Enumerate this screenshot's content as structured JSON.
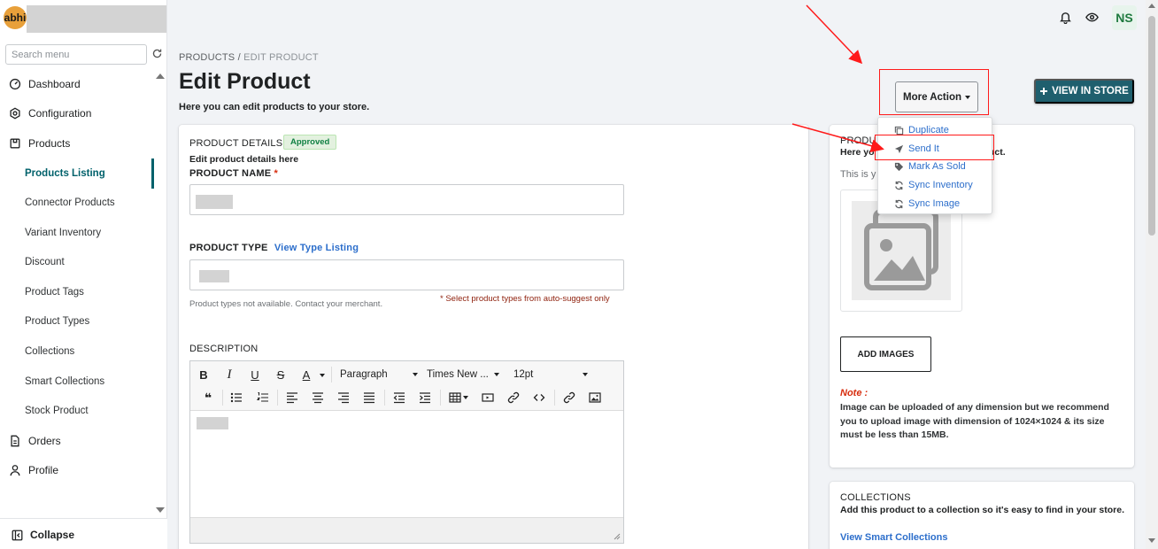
{
  "brand": {
    "initials": "abhi"
  },
  "sidebar": {
    "search_placeholder": "Search menu",
    "items": [
      {
        "label": "Dashboard"
      },
      {
        "label": "Configuration"
      },
      {
        "label": "Products"
      },
      {
        "label": "Orders"
      },
      {
        "label": "Profile"
      }
    ],
    "product_sub": [
      {
        "label": "Products Listing",
        "active": true
      },
      {
        "label": "Connector Products"
      },
      {
        "label": "Variant Inventory"
      },
      {
        "label": "Discount"
      },
      {
        "label": "Product Tags"
      },
      {
        "label": "Product Types"
      },
      {
        "label": "Collections"
      },
      {
        "label": "Smart Collections"
      },
      {
        "label": "Stock Product"
      }
    ],
    "collapse_label": "Collapse"
  },
  "topbar": {
    "user_initials": "NS"
  },
  "header": {
    "breadcrumb_parent": "PRODUCTS",
    "breadcrumb_sep": " / ",
    "breadcrumb_current": "EDIT PRODUCT",
    "title": "Edit Product",
    "subtitle": "Here you can edit products to your store.",
    "more_action_label": "More Action",
    "view_store_label": "VIEW IN STORE"
  },
  "more_action_menu": [
    {
      "label": "Duplicate",
      "icon": "copy-icon"
    },
    {
      "label": "Send It",
      "icon": "send-icon"
    },
    {
      "label": "Mark As Sold",
      "icon": "tag-icon"
    },
    {
      "label": "Sync Inventory",
      "icon": "sync-icon"
    },
    {
      "label": "Sync Image",
      "icon": "sync-icon"
    }
  ],
  "product_details": {
    "heading": "PRODUCT DETAILS",
    "status_badge": "Approved",
    "description": "Edit product details here",
    "name_label": "PRODUCT NAME",
    "required_mark": "*",
    "type_label": "PRODUCT TYPE",
    "type_link": "View Type Listing",
    "type_help": "Product types not available. Contact your merchant.",
    "type_error": "* Select product types from auto-suggest only",
    "desc_label": "DESCRIPTION"
  },
  "editor": {
    "bold": "B",
    "italic": "I",
    "underline": "U",
    "strike": "S",
    "font_color": "A",
    "block_format": "Paragraph",
    "font_family": "Times New ...",
    "font_size": "12pt",
    "blockquote": "❝"
  },
  "media_card": {
    "heading_visible": "PRODU",
    "subtitle_visible": "Here yo",
    "subtitle_tail": "uct.",
    "info_visible": "This is y",
    "add_images_label": "ADD IMAGES",
    "note_title": "Note :",
    "note_text": "Image can be uploaded of any dimension but we recommend you to upload image with dimension of 1024×1024 & its size must be less than 15MB."
  },
  "collections_card": {
    "heading": "COLLECTIONS",
    "subtitle": "Add this product to a collection so it's easy to find in your store.",
    "link": "View Smart Collections"
  },
  "colors": {
    "accent": "#00616b",
    "primary_button": "#1f5f6e",
    "link": "#2c6ecb",
    "annotation_red": "#ff1a1a",
    "badge_green": "#108043"
  }
}
